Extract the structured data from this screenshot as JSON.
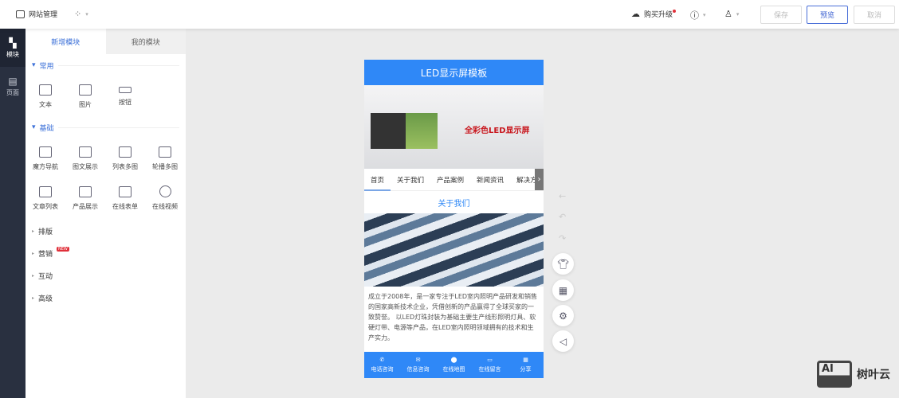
{
  "topbar": {
    "site_manage": "网站管理",
    "upgrade": "购买升级",
    "save": "保存",
    "preview": "预览",
    "cancel": "取消"
  },
  "rail": [
    {
      "label": "模块"
    },
    {
      "label": "页面"
    }
  ],
  "panel": {
    "tabs": [
      "新增模块",
      "我的模块"
    ],
    "common": {
      "title": "常用",
      "items": [
        "文本",
        "图片",
        "按钮"
      ]
    },
    "basic": {
      "title": "基础",
      "items": [
        "魔方导航",
        "图文展示",
        "列表多图",
        "轮播多图",
        "文章列表",
        "产品展示",
        "在线表单",
        "在线视频"
      ]
    },
    "collapsed": [
      "排版",
      "营销",
      "互动",
      "高级"
    ],
    "new_badge": "NEW"
  },
  "phone": {
    "title": "LED显示屏模板",
    "banner_headline": "全彩色LED显示屏",
    "nav": [
      "首页",
      "关于我们",
      "产品案例",
      "新闻资讯",
      "解决方案"
    ],
    "section_title": "关于我们",
    "body": "成立于2008年，是一家专注于LED室内照明产品研发和销售的国家高新技术企业，凭借创新的产品赢得了全球买家的一致赞誉。 以LED灯珠封装为基础主要生产线形照明灯具、软硬灯带、电源等产品，在LED室内照明领域拥有的技术和生产实力。",
    "footer": [
      "电话咨询",
      "信息咨询",
      "在线地图",
      "在线留言",
      "分享"
    ]
  },
  "watermark": {
    "text": "树叶云",
    "logo": "AI"
  },
  "colors": {
    "primary": "#2f88f7",
    "sidebar": "#293040"
  }
}
